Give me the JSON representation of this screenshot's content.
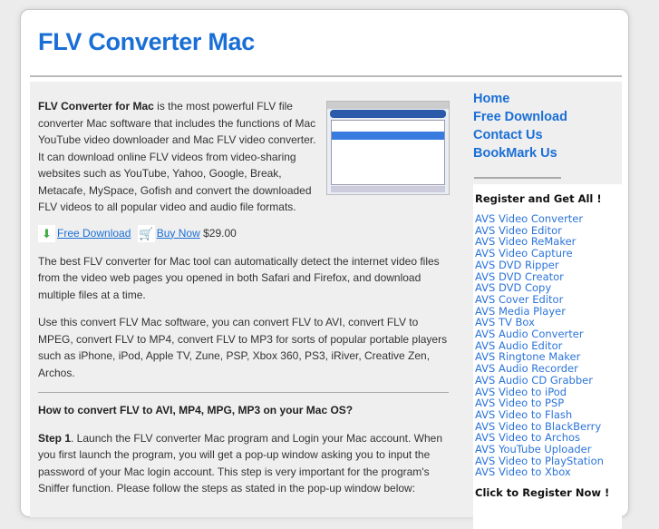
{
  "header": {
    "title": "FLV Converter Mac"
  },
  "main": {
    "intro_bold": "FLV Converter for Mac",
    "intro_text": " is the most powerful FLV file converter Mac software that includes the functions of Mac YouTube video downloader and Mac FLV video converter. It can download online FLV videos from video-sharing websites such as YouTube, Yahoo, Google, Break, Metacafe, MySpace, Gofish and convert the downloaded FLV videos to all popular video and audio file formats.",
    "free_download": "Free Download",
    "buy_now": "Buy Now",
    "price": "$29.00",
    "para2": "The best FLV converter for Mac tool can automatically detect the internet video files from the video web pages you opened in both Safari and Firefox, and download multiple files at a time.",
    "para3": "Use this convert FLV Mac software, you can convert FLV to AVI, convert FLV to MPEG, convert FLV to MP4, convert FLV to MP3 for sorts of popular portable players such as iPhone, iPod, Apple TV, Zune, PSP, Xbox 360, PS3, iRiver, Creative Zen, Archos.",
    "howto_heading": "How to convert FLV to AVI, MP4, MPG, MP3 on your Mac OS?",
    "step1_label": "Step 1",
    "step1_text": ". Launch the FLV converter Mac program and Login your Mac account. When you first launch the program, you will get a pop-up window asking you to input the password of your Mac login account. This step is very important for the program's Sniffer function. Please follow the steps as stated in the pop-up window below:"
  },
  "sidebar": {
    "nav": [
      "Home",
      "Free Download",
      "Contact Us",
      "BookMark Us"
    ],
    "register_heading": "Register and Get All !",
    "products": [
      "AVS Video Converter",
      "AVS Video Editor",
      "AVS Video ReMaker",
      "AVS Video Capture",
      "AVS DVD Ripper",
      "AVS DVD Creator",
      "AVS DVD Copy",
      "AVS Cover Editor",
      "AVS Media Player",
      "AVS TV Box",
      "AVS Audio Converter",
      "AVS Audio Editor",
      "AVS Ringtone Maker",
      "AVS Audio Recorder",
      "AVS Audio CD Grabber",
      "AVS Video to iPod",
      "AVS Video to PSP",
      "AVS Video to Flash",
      "AVS Video to BlackBerry",
      "AVS Video to Archos",
      "AVS YouTube Uploader",
      "AVS Video to PlayStation",
      "AVS Video to Xbox"
    ],
    "register_cta": "Click to Register Now !"
  }
}
